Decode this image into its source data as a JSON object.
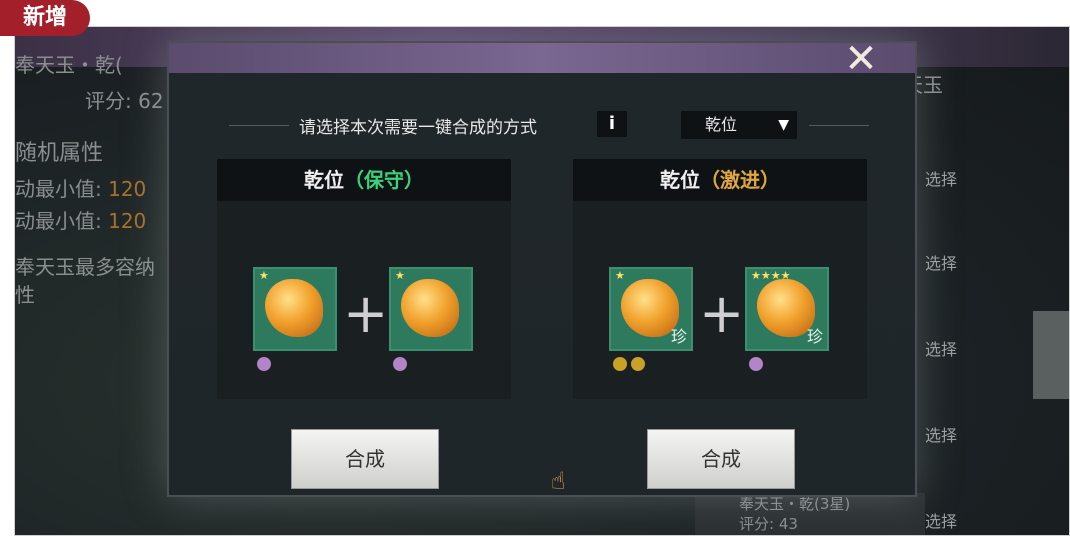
{
  "badge": "新增",
  "background": {
    "item_title": "奉天玉・乾(",
    "score_label": "评分: 62",
    "attr_header": "随机属性",
    "attr_1_label": "动最小值:",
    "attr_1_value": "120",
    "attr_2_label": "动最小值:",
    "attr_2_value": "120",
    "desc": "奉天玉最多容纳",
    "desc2": "性",
    "right_title": "天玉",
    "select_label": "选择",
    "bottom_item_title": "奉天玉・乾(3星)",
    "bottom_item_score": "评分: 43"
  },
  "dialog": {
    "close_icon": "close-icon",
    "prompt": "请选择本次需要一键合成的方式",
    "info_label": "i",
    "mode_value": "乾位",
    "panels": [
      {
        "name": "乾位",
        "style": "保守",
        "style_color": "#3bd27a",
        "left_gem": {
          "stars": "★",
          "rare": ""
        },
        "right_gem": {
          "stars": "★",
          "rare": ""
        },
        "button": "合成"
      },
      {
        "name": "乾位",
        "style": "激进",
        "style_color": "#e0a640",
        "left_gem": {
          "stars": "★",
          "rare": "珍"
        },
        "right_gem": {
          "stars": "★★★★",
          "rare": "珍"
        },
        "button": "合成"
      }
    ]
  }
}
